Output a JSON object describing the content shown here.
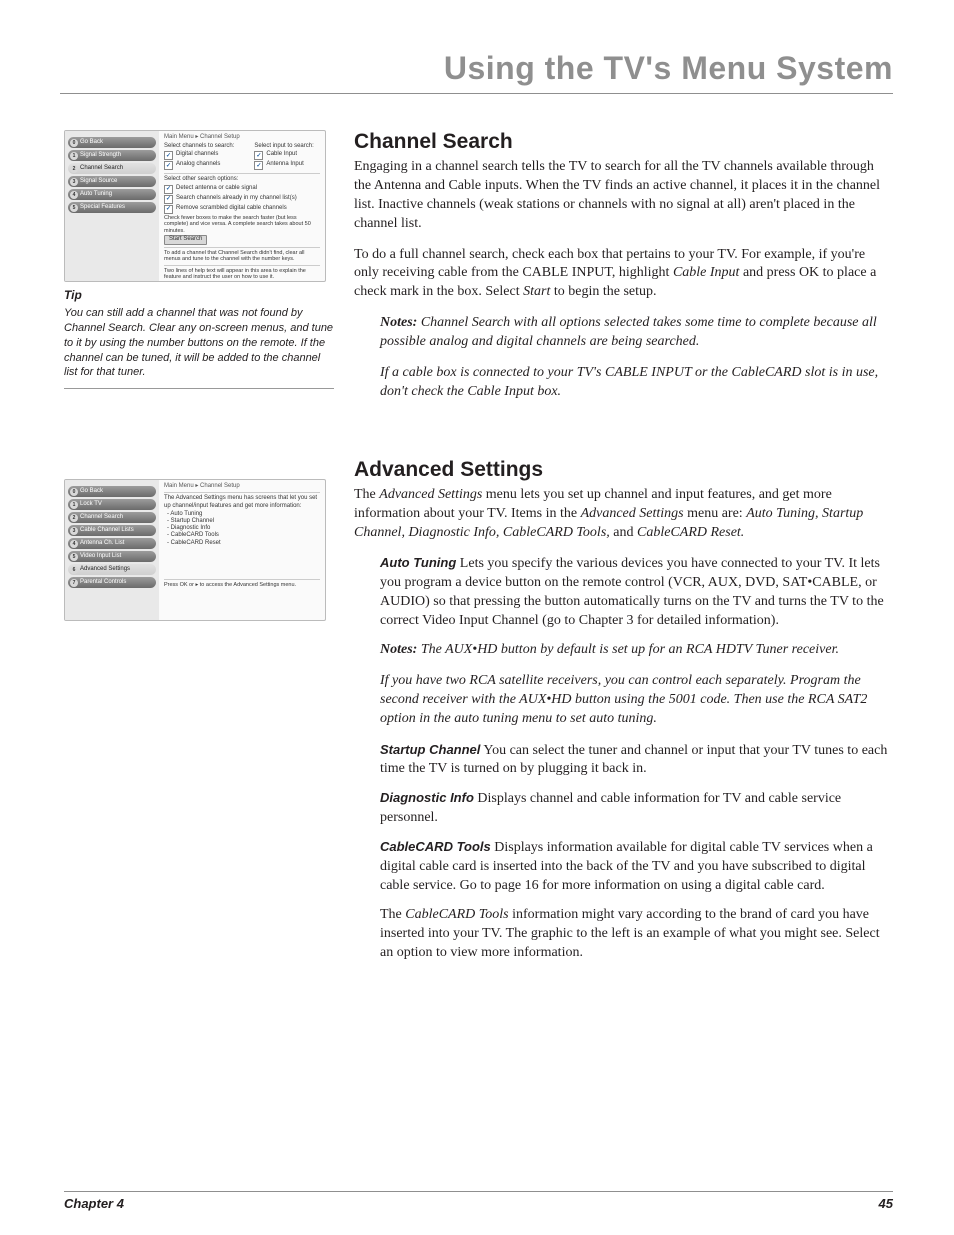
{
  "runningHead": "Using the TV's Menu System",
  "screenshot1": {
    "crumb": "Main Menu ▸ Channel Setup",
    "nav": [
      {
        "n": "0",
        "label": "Go Back"
      },
      {
        "n": "1",
        "label": "Signal Strength"
      },
      {
        "n": "2",
        "label": "Channel Search",
        "active": true
      },
      {
        "n": "3",
        "label": "Signal Source"
      },
      {
        "n": "4",
        "label": "Auto Tuning"
      },
      {
        "n": "5",
        "label": "Special Features"
      }
    ],
    "colA_head": "Select channels to search:",
    "colB_head": "Select input to search:",
    "colA": [
      "Digital channels",
      "Analog channels"
    ],
    "colB": [
      "Cable Input",
      "Antenna Input"
    ],
    "otherHead": "Select other search options:",
    "other": [
      "Detect antenna or cable signal",
      "Search channels already in my channel list(s)",
      "Remove scrambled digital cable channels"
    ],
    "hint1": "Check fewer boxes to make the search faster (but less complete) and vice versa. A complete search takes about 50 minutes.",
    "button": "Start Search",
    "hint2": "To add a channel that Channel Search didn't find, clear all menus and tune to the channel with the number keys.",
    "help": "Two lines of help text will appear in this area to explain the feature and instruct the user on how to use it."
  },
  "tip": {
    "head": "Tip",
    "body": "You can still add a channel that was not found by Channel Search. Clear any on-screen menus, and tune to it by using the number buttons on the remote. If the channel can be tuned, it will be added to the channel list for that tuner."
  },
  "screenshot2": {
    "crumb": "Main Menu ▸ Channel Setup",
    "nav": [
      {
        "n": "0",
        "label": "Go Back"
      },
      {
        "n": "1",
        "label": "Lock TV"
      },
      {
        "n": "2",
        "label": "Channel Search"
      },
      {
        "n": "3",
        "label": "Cable Channel Lists"
      },
      {
        "n": "4",
        "label": "Antenna Ch. List"
      },
      {
        "n": "5",
        "label": "Video Input List"
      },
      {
        "n": "6",
        "label": "Advanced Settings",
        "active": true
      },
      {
        "n": "7",
        "label": "Parental Controls"
      }
    ],
    "intro": "The Advanced Settings menu has screens that let you set up channel/input features and get more information:",
    "items": [
      "Auto Tuning",
      "Startup Channel",
      "Diagnostic Info",
      "CableCARD Tools",
      "CableCARD Reset"
    ],
    "help": "Press OK or ▸ to access the Advanced Settings menu."
  },
  "section1": {
    "title": "Channel Search",
    "p1": "Engaging in a channel search tells the TV to search for all the TV channels available through the Antenna and Cable inputs. When the TV finds an active channel, it places it in the channel list. Inactive channels (weak stations or channels with no signal at all) aren't placed in the channel list.",
    "p2a": "To do a full channel search, check each box that pertains to your TV. For example, if you're only receiving cable from the CABLE INPUT, highlight ",
    "p2b": "Cable Input",
    "p2c": " and press OK to place a check mark in the box. Select ",
    "p2d": "Start",
    "p2e": " to begin the setup.",
    "noteLead": "Notes:",
    "note1": " Channel Search with all options selected takes some time to complete because all possible analog and digital channels are being searched.",
    "note2": "If a cable box is connected to your TV's CABLE INPUT or the CableCARD slot is in use, don't check the Cable Input box."
  },
  "section2": {
    "title": "Advanced Settings",
    "p1a": "The ",
    "p1b": "Advanced Settings",
    "p1c": " menu lets you set up channel and input features, and get more information about your TV. Items in the ",
    "p1d": "Advanced Settings",
    "p1e": " menu are: ",
    "p1f": "Auto Tuning, Startup Channel, Diagnostic Info, CableCARD Tools,",
    "p1g": " and ",
    "p1h": "CableCARD Reset.",
    "auto": {
      "lead": "Auto Tuning",
      "body": "   Lets you specify the various devices you have connected to your TV. It lets you program a device button on the remote control (VCR, AUX, DVD, SAT•CABLE, or AUDIO) so that pressing the button automatically turns on the TV and turns the TV to the correct Video Input Channel (go to Chapter 3 for detailed information)."
    },
    "autoNotesLead": "Notes:",
    "autoNote1": " The AUX•HD button by default is set up for an RCA HDTV Tuner receiver.",
    "autoNote2": "If you have two RCA satellite receivers, you can control each separately. Program the second receiver with the AUX•HD button using the 5001 code. Then use the RCA SAT2 option in the auto tuning menu to set auto tuning.",
    "startup": {
      "lead": "Startup Channel",
      "body": "   You can select the tuner and channel or input that your TV tunes to each time the TV is turned on by plugging it back in."
    },
    "diag": {
      "lead": "Diagnostic Info",
      "body": "   Displays channel and cable information for TV and cable service personnel."
    },
    "cct": {
      "lead": "CableCARD Tools",
      "body": "   Displays information available for digital cable TV services when a digital cable card is inserted into the back of the TV and you have subscribed to digital cable service. Go to page 16 for more information on using a digital cable card."
    },
    "cct2a": "The ",
    "cct2b": "CableCARD Tools",
    "cct2c": " information might vary according to the brand of card you have inserted into your TV. The graphic to the left is an example of what you might see. Select an option to view more information."
  },
  "footer": {
    "left": "Chapter 4",
    "right": "45"
  }
}
